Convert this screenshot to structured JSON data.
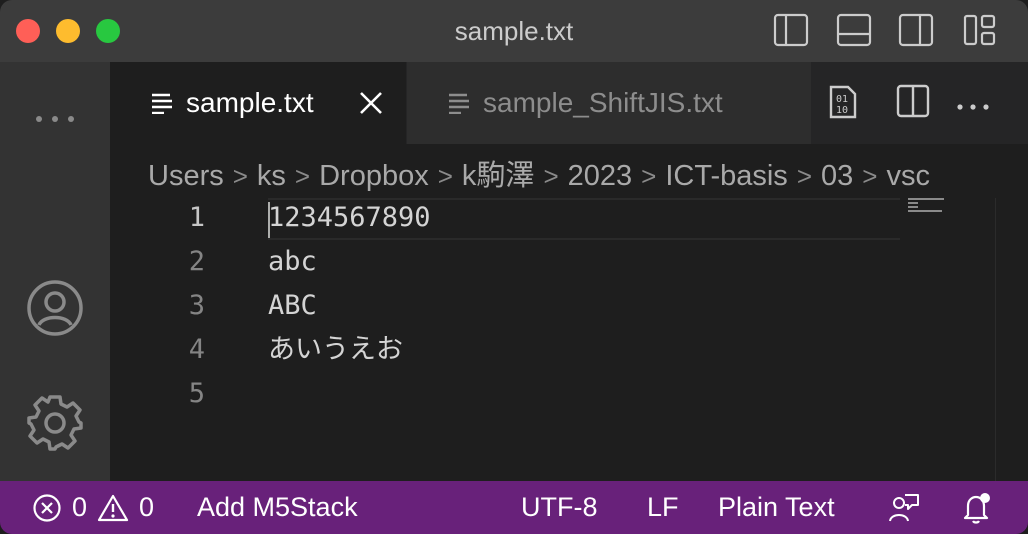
{
  "window": {
    "title": "sample.txt"
  },
  "colors": {
    "titlebar": "#3c3c3c",
    "activitybar": "#333333",
    "editor": "#1e1e1e",
    "statusbar": "#68217a",
    "close": "#ff5f57",
    "minimize": "#febc2e",
    "maximize": "#28c840"
  },
  "titlebar_icons": [
    "toggle-primary-sidebar-icon",
    "toggle-panel-icon",
    "toggle-secondary-sidebar-icon",
    "customize-layout-icon"
  ],
  "activitybar": {
    "items": [
      "more-icon",
      "account-icon",
      "settings-gear-icon"
    ]
  },
  "tabs": [
    {
      "label": "sample.txt",
      "active": true,
      "icon": "text-file-icon",
      "close_icon": "close-icon"
    },
    {
      "label": "sample_ShiftJIS.txt",
      "active": false,
      "icon": "text-file-icon"
    }
  ],
  "tab_actions": [
    "open-binary-icon",
    "split-editor-icon",
    "more-actions-icon"
  ],
  "breadcrumb": [
    "Users",
    "ks",
    "Dropbox",
    "k駒澤",
    "2023",
    "ICT-basis",
    "03",
    "vsc"
  ],
  "editor": {
    "lines": [
      {
        "number": "1",
        "text": "1234567890"
      },
      {
        "number": "2",
        "text": "abc"
      },
      {
        "number": "3",
        "text": "ABC"
      },
      {
        "number": "4",
        "text": "あいうえお"
      },
      {
        "number": "5",
        "text": ""
      }
    ],
    "active_line": 1
  },
  "statusbar": {
    "errors": "0",
    "warnings": "0",
    "m5stack": "Add M5Stack",
    "encoding": "UTF-8",
    "eol": "LF",
    "language": "Plain Text",
    "feedback_icon": "feedback-icon",
    "notifications_icon": "bell-icon"
  }
}
